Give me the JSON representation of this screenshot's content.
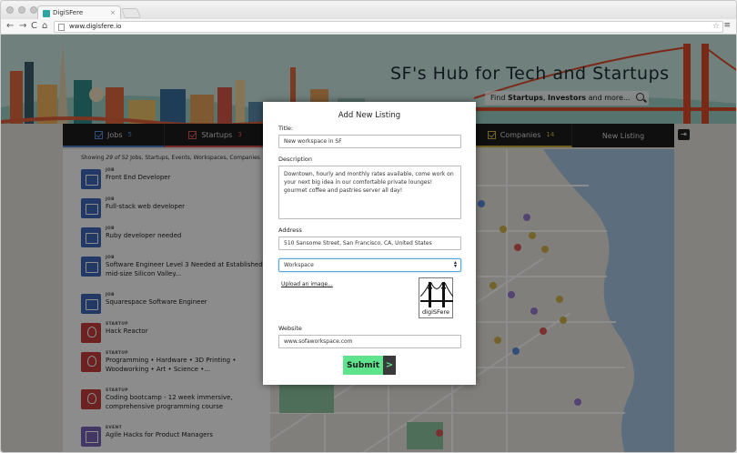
{
  "browser": {
    "tab_title": "DigiSFere",
    "tab_close": "×",
    "url": "www.digisfere.io",
    "back": "←",
    "forward": "→",
    "reload": "C",
    "home": "⌂",
    "star": "☆",
    "menu": "≡"
  },
  "banner": {
    "title": "SF's Hub for Tech and Startups",
    "search_pre": "Find ",
    "search_b1": "Startups",
    "search_mid": ", ",
    "search_b2": "Investors",
    "search_post": " and more..."
  },
  "tabs": {
    "jobs": {
      "label": "Jobs",
      "count": "5"
    },
    "startups": {
      "label": "Startups",
      "count": "3"
    },
    "companies": {
      "label": "Companies",
      "count": "14"
    },
    "new_listing": {
      "label": "New Listing"
    }
  },
  "logout_icon": "⇥",
  "sidebar": {
    "showing_pre": "Showing ",
    "showing_count": "29 of 52",
    "showing_post": " Jobs, Startups, Events, Workspaces, Companies",
    "items": [
      {
        "category": "JOB",
        "title": "Front End Developer",
        "kind": "job"
      },
      {
        "category": "JOB",
        "title": "Full-stack web developer",
        "kind": "job"
      },
      {
        "category": "JOB",
        "title": "Ruby developer needed",
        "kind": "job"
      },
      {
        "category": "JOB",
        "title": "Software Engineer Level 3 Needed at Established mid-size Silicon Valley...",
        "kind": "job"
      },
      {
        "category": "JOB",
        "title": "Squarespace Software Engineer",
        "kind": "job"
      },
      {
        "category": "STARTUP",
        "title": "Hack Reactor",
        "kind": "startup"
      },
      {
        "category": "STARTUP",
        "title": "Programming • Hardware • 3D Printing • Woodworking • Art • Science •...",
        "kind": "startup"
      },
      {
        "category": "STARTUP",
        "title": "Coding bootcamp - 12 week immersive, comprehensive programming course",
        "kind": "startup"
      },
      {
        "category": "EVENT",
        "title": "Agile Hacks for Product Managers",
        "kind": "event"
      }
    ]
  },
  "modal": {
    "heading": "Add New Listing",
    "title_label": "Title:",
    "title_value": "New workspace in SF",
    "description_label": "Description",
    "description_value": "Downtown, hourly and monthly rates available, come work on your next big idea in our comfortable private lounges! gourmet coffee and pastries server all day!",
    "address_label": "Address",
    "address_value": "510 Sansome Street, San Francisco, CA, United States",
    "type_value": "Workspace",
    "upload_label": "Upload an image...",
    "logo_text": "digiSFere",
    "website_label": "Website",
    "website_value": "www.sofaworkspace.com",
    "submit_label": "Submit",
    "submit_arrow": ">"
  }
}
